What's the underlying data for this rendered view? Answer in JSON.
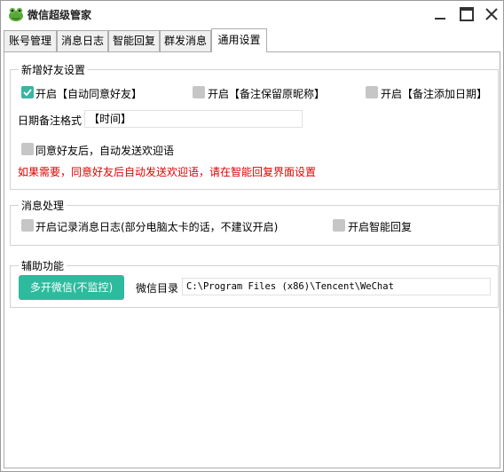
{
  "window": {
    "title": "微信超级管家",
    "icon": "frog-icon",
    "minimize_icon": "minimize-icon",
    "maximize_icon": "maximize-icon",
    "close_icon": "close-icon"
  },
  "tabs": [
    {
      "label": "账号管理",
      "active": false
    },
    {
      "label": "消息日志",
      "active": false
    },
    {
      "label": "智能回复",
      "active": false
    },
    {
      "label": "群发消息",
      "active": false
    },
    {
      "label": "通用设置",
      "active": true
    }
  ],
  "new_friend": {
    "legend": "新增好友设置",
    "auto_accept": {
      "label": "开启【自动同意好友】",
      "checked": true
    },
    "keep_nickname": {
      "label": "开启【备注保留原昵称】",
      "checked": false
    },
    "add_date": {
      "label": "开启【备注添加日期】",
      "checked": false
    },
    "date_format_label": "日期备注格式",
    "date_format_value": "【时间】",
    "welcome": {
      "label": "同意好友后，自动发送欢迎语",
      "checked": false
    },
    "hint": "如果需要，同意好友后自动发送欢迎语，请在智能回复界面设置"
  },
  "message": {
    "legend": "消息处理",
    "log": {
      "label": "开启记录消息日志(部分电脑太卡的话，不建议开启)",
      "checked": false
    },
    "smart_reply": {
      "label": "开启智能回复",
      "checked": false
    }
  },
  "aux": {
    "legend": "辅助功能",
    "multi_button": "多开微信(不监控)",
    "dir_label": "微信目录",
    "dir_value": "C:\\Program Files (x86)\\Tencent\\WeChat"
  },
  "colors": {
    "accent": "#2dbb9e",
    "checkbox_on": "#3ab5a1",
    "checkbox_off": "#c6c6c6",
    "hint_red": "#e00000"
  }
}
